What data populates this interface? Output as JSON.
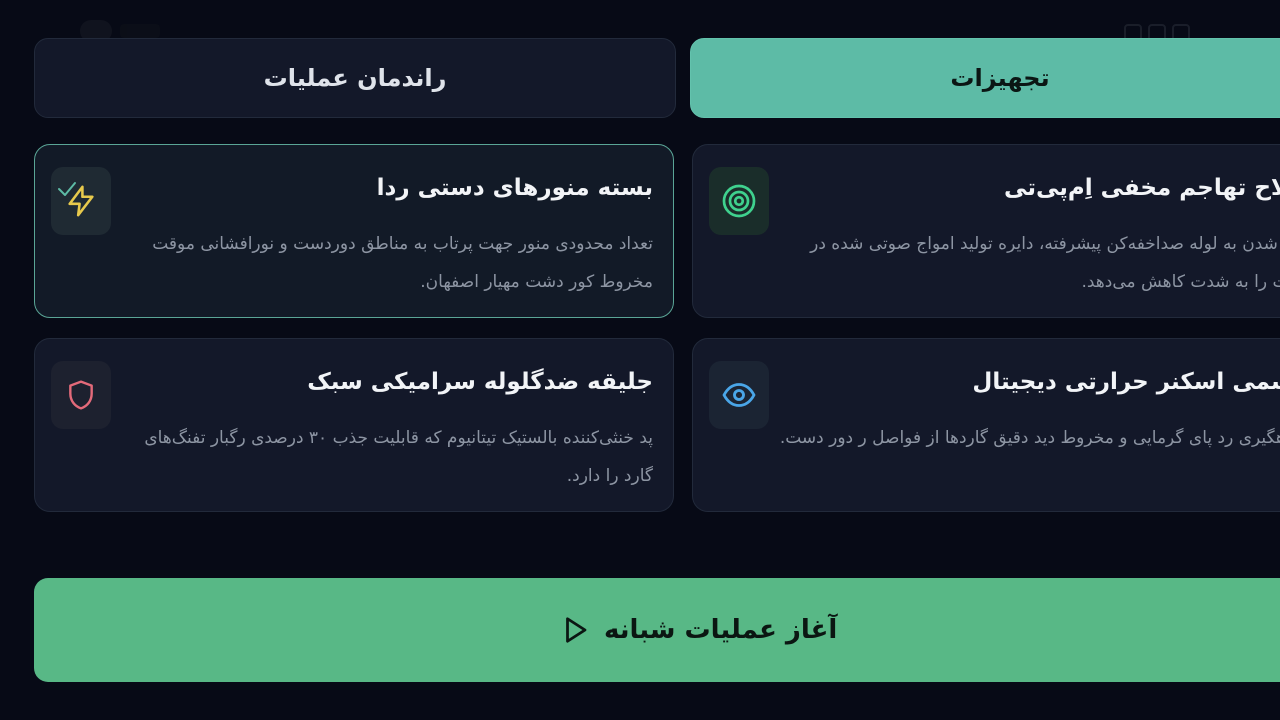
{
  "tabs": {
    "operations_label": "راندمان عملیات",
    "equipment_label": "تجهیزات"
  },
  "cards": {
    "flares": {
      "title": "بسته منورهای دستی ردا",
      "description": "تعداد محدودی منور جهت پرتاب به مناطق دوردست و نورافشانی موقت مخروط کور دشت مهیار اصفهان.",
      "icon": "lightning-icon",
      "selected": true
    },
    "emp": {
      "title": "سلاح تهاجم مخفی اِم‌پی‌تی",
      "description": "جهز شدن به لوله صداخفه‌کن پیشرفته، دایره تولید امواج صوتی شده در دشت را به شدت کاهش می‌دهد.",
      "icon": "target-icon"
    },
    "vest": {
      "title": "جلیقه ضدگلوله سرامیکی سبک",
      "description": "پد خنثی‌کننده بالستیک تیتانیوم که قابلیت جذب ۳۰ درصدی رگبار تفنگ‌های گارد را دارد.",
      "icon": "shield-icon"
    },
    "thermal": {
      "title": "چشمی اسکنر حرارتی دیجیتال",
      "description": "ن رهگیری رد پای گرمایی و مخروط دید دقیق گاردها از فواصل ر دور دست.",
      "icon": "eye-icon"
    }
  },
  "start_button": {
    "label": "آغاز عملیات شبانه",
    "icon": "play-icon"
  },
  "colors": {
    "background": "#070a16",
    "card": "#131829",
    "accent_teal": "#5dbba6",
    "accent_green": "#58b886",
    "icon_yellow": "#e7c94c",
    "icon_green": "#3fd18e",
    "icon_red": "#e36a7a",
    "icon_blue": "#4aa6e8"
  }
}
